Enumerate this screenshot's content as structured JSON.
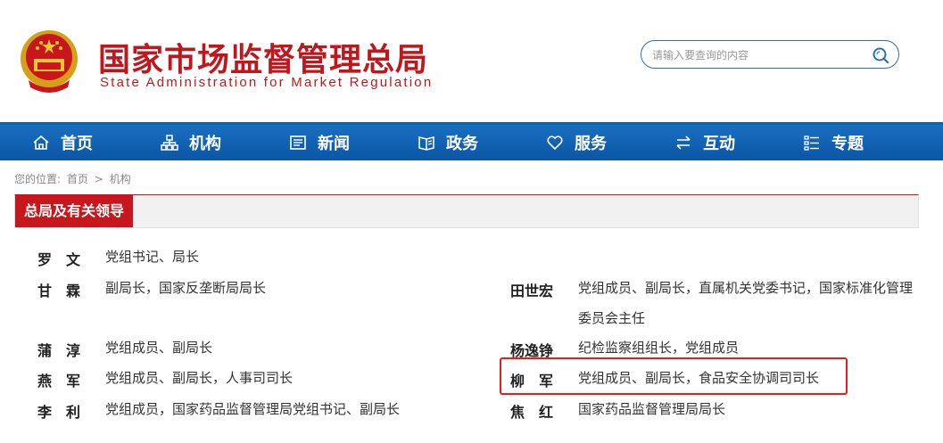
{
  "header": {
    "title_cn": "国家市场监督管理总局",
    "title_en": "State Administration for Market Regulation",
    "emblem": "national-emblem-icon",
    "search_placeholder": "请输入要查询的内容"
  },
  "nav": {
    "items": [
      {
        "label": "首页",
        "icon": "home-icon"
      },
      {
        "label": "机构",
        "icon": "org-chart-icon"
      },
      {
        "label": "新闻",
        "icon": "newspaper-icon"
      },
      {
        "label": "政务",
        "icon": "book-icon"
      },
      {
        "label": "服务",
        "icon": "heart-icon"
      },
      {
        "label": "互动",
        "icon": "swap-arrows-icon"
      },
      {
        "label": "专题",
        "icon": "list-icon"
      }
    ]
  },
  "breadcrumb": {
    "prefix": "您的位置:",
    "items": [
      "首页",
      "机构"
    ],
    "separator": ">"
  },
  "section": {
    "title": "总局及有关领导"
  },
  "leaders_left": [
    {
      "name": "罗　文",
      "role": "党组书记、局长"
    },
    {
      "name": "甘　霖",
      "role": "副局长，国家反垄断局局长"
    },
    {
      "name": "蒲　淳",
      "role": "党组成员、副局长"
    },
    {
      "name": "燕　军",
      "role": "党组成员、副局长，人事司司长"
    },
    {
      "name": "李　利",
      "role": "党组成员，国家药品监督管理局党组书记、副局长"
    }
  ],
  "leaders_right": [
    {
      "name": "田世宏",
      "role": "党组成员、副局长，直属机关党委书记，国家标准化管理委员会主任"
    },
    {
      "name": "杨逸铮",
      "role": "纪检监察组组长，党组成员"
    },
    {
      "name": "柳　军",
      "role": "党组成员、副局长，食品安全协调司司长"
    },
    {
      "name": "焦　红",
      "role": "国家药品监督管理局局长"
    }
  ],
  "colors": {
    "brand_red": "#c0171d",
    "nav_blue": "#0b5eae",
    "highlight": "#e0201b"
  }
}
